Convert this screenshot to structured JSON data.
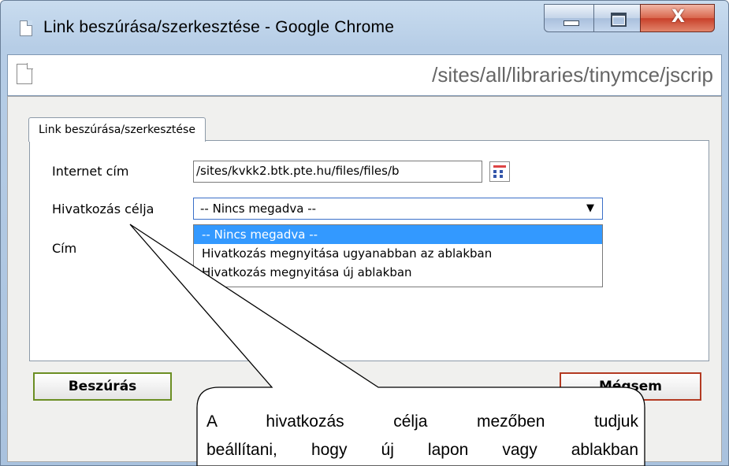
{
  "window": {
    "title": "Link beszúrása/szerkesztése - Google Chrome",
    "close_glyph": "X",
    "address": "/sites/all/libraries/tinymce/jscrip"
  },
  "dialog": {
    "tab_label": "Link beszúrása/szerkesztése",
    "fields": {
      "url_label": "Internet cím",
      "url_value": "/sites/kvkk2.btk.pte.hu/files/files/b",
      "target_label": "Hivatkozás célja",
      "target_selected": "-- Nincs megadva --",
      "title_label": "Cím"
    },
    "target_options": [
      "-- Nincs megadva --",
      "Hivatkozás megnyitása ugyanabban az ablakban",
      "Hivatkozás megnyitása új ablakban"
    ],
    "insert_label": "Beszúrás",
    "cancel_label": "Mégsem"
  },
  "callout": {
    "line1": "A hivatkozás célja mezőben tudjuk",
    "line2": "beállítani, hogy új lapon vagy ablakban"
  },
  "colors": {
    "selection": "#3399ff",
    "insert_border": "#6b8e23",
    "cancel_border": "#b33a22"
  }
}
